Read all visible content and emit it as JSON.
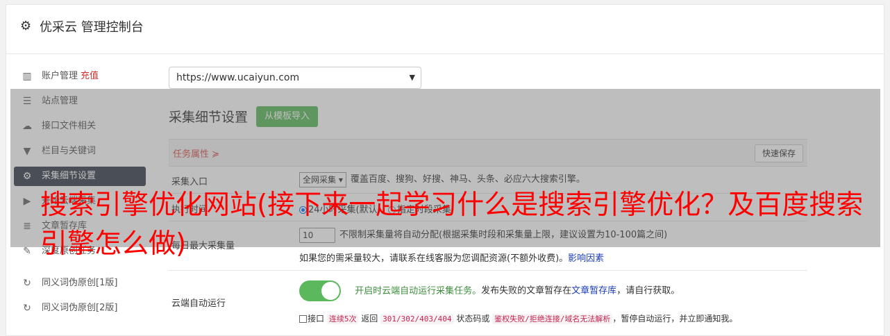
{
  "header": {
    "title": "优采云 管理控制台"
  },
  "sidebar": {
    "items": [
      {
        "label": "账户管理",
        "extra": "充值"
      },
      {
        "label": "站点管理"
      },
      {
        "label": "接口文件相关"
      },
      {
        "label": "栏目与关键词"
      },
      {
        "label": "采集细节设置"
      },
      {
        "label": "开始云端采集"
      },
      {
        "label": "文章暂存库"
      },
      {
        "label": "深度原创任务"
      },
      {
        "label": "同义词伪原创[1版]"
      },
      {
        "label": "同义词伪原创[2版]"
      }
    ]
  },
  "site_select": {
    "value": "https://www.ucaiyun.com"
  },
  "section": {
    "title": "采集细节设置",
    "import_button": "从模板导入"
  },
  "props": {
    "label": "任务属性 ≽",
    "save_button": "快速保存"
  },
  "rows": {
    "entry": {
      "label": "采集入口",
      "select": "全网采集",
      "desc": "覆盖百度、搜狗、好搜、神马、头条、必应六大搜索引擎。"
    },
    "time": {
      "label": "执行时间",
      "opt1": "24小时采集(默认)",
      "opt2": "指定时段采集"
    },
    "count": {
      "label": "每日最大采集量",
      "value": "10",
      "desc": "不限制采集量将自动分配(根据采集时段和采集量上限，建议设置为10-100篇之间)",
      "note": "如果您的需采量较大，请联系在线客服为您调配资源(不额外收费)。",
      "note_link": "影响因素"
    },
    "cloud": {
      "label": "云端自动运行",
      "toggle_text": "开启时云端自动运行采集任务。",
      "desc_pre": "发布失败的文章暂存在",
      "desc_link": "文章暂存库",
      "desc_post": "，请自行获取。",
      "chk_pre": "接口",
      "tag1": "连续5次",
      "chk_mid1": "返回",
      "tag2": "301/302/403/404",
      "chk_mid2": "状态码或",
      "tag3": "鉴权失败/拒绝连接/域名无法解析",
      "chk_post": "，暂停自动运行，并立即通知我。"
    }
  },
  "overlay": {
    "headline": "搜索引擎优化网站(接下来一起学习什么是搜索引擎优化？及百度搜索引擎怎么做)"
  }
}
